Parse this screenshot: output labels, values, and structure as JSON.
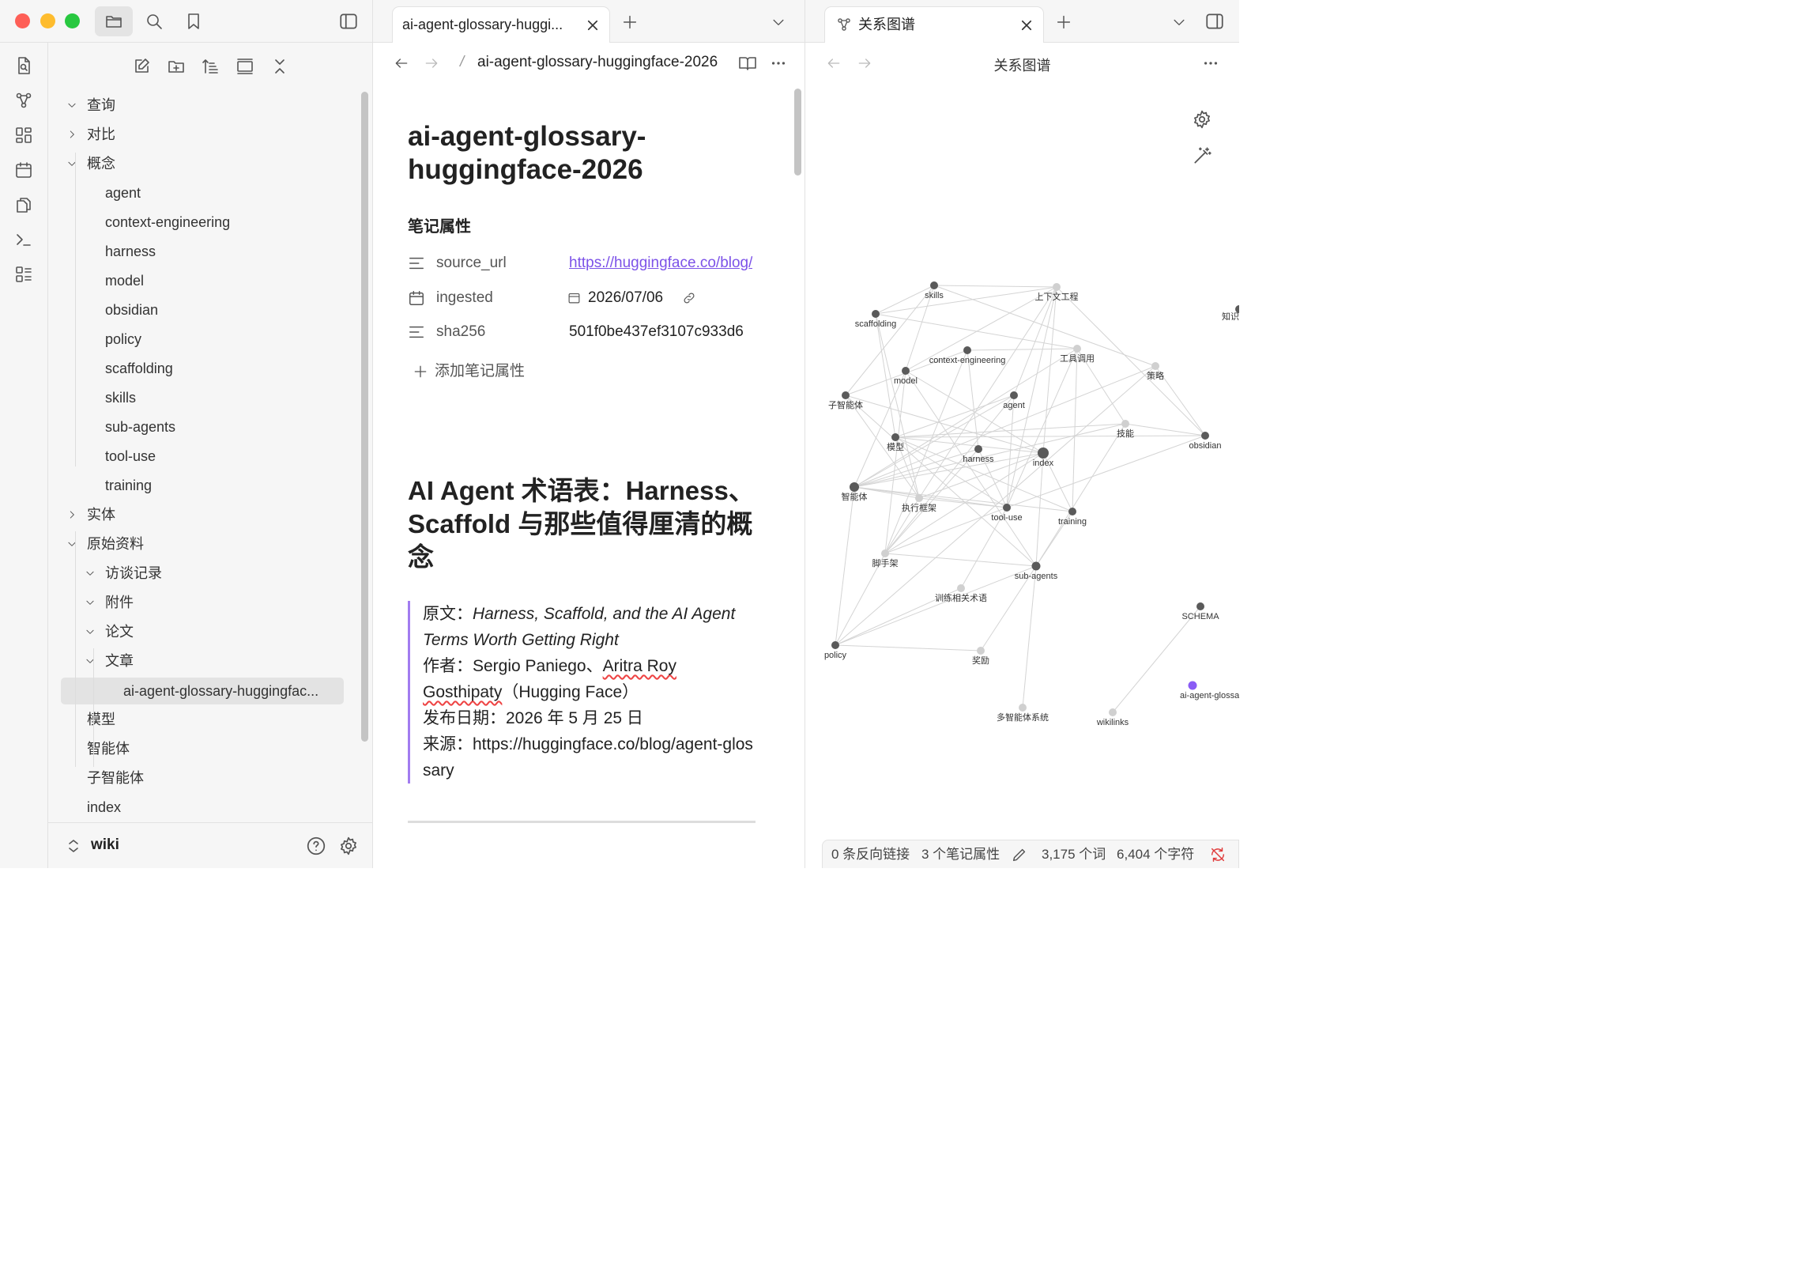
{
  "sidebar": {
    "vault_name": "wiki",
    "tree": [
      {
        "label": "查询",
        "type": "folder",
        "expanded": true
      },
      {
        "label": "对比",
        "type": "folder",
        "expanded": false
      },
      {
        "label": "概念",
        "type": "folder",
        "expanded": true
      },
      {
        "label": "agent",
        "type": "file"
      },
      {
        "label": "context-engineering",
        "type": "file"
      },
      {
        "label": "harness",
        "type": "file"
      },
      {
        "label": "model",
        "type": "file"
      },
      {
        "label": "obsidian",
        "type": "file"
      },
      {
        "label": "policy",
        "type": "file"
      },
      {
        "label": "scaffolding",
        "type": "file"
      },
      {
        "label": "skills",
        "type": "file"
      },
      {
        "label": "sub-agents",
        "type": "file"
      },
      {
        "label": "tool-use",
        "type": "file"
      },
      {
        "label": "training",
        "type": "file"
      },
      {
        "label": "实体",
        "type": "folder",
        "expanded": false
      },
      {
        "label": "原始资料",
        "type": "folder",
        "expanded": true
      },
      {
        "label": "访谈记录",
        "type": "folder",
        "expanded": true
      },
      {
        "label": "附件",
        "type": "folder",
        "expanded": true
      },
      {
        "label": "论文",
        "type": "folder",
        "expanded": true
      },
      {
        "label": "文章",
        "type": "folder",
        "expanded": true
      },
      {
        "label": "ai-agent-glossary-huggingfac...",
        "type": "file",
        "selected": true
      },
      {
        "label": "模型",
        "type": "file"
      },
      {
        "label": "智能体",
        "type": "file"
      },
      {
        "label": "子智能体",
        "type": "file"
      },
      {
        "label": "index",
        "type": "file"
      }
    ]
  },
  "left_pane": {
    "tab_title": "ai-agent-glossary-huggi...",
    "breadcrumb_sep": "/",
    "breadcrumb": "ai-agent-glossary-huggingface-2026",
    "note_title": "ai-agent-glossary-huggingface-2026",
    "properties_heading": "笔记属性",
    "properties": [
      {
        "key": "source_url",
        "value": "https://huggingface.co/blog/agent-glossary",
        "icon": "text-lines-icon"
      },
      {
        "key": "ingested",
        "value": "2026/07/06",
        "icon": "calendar-icon"
      },
      {
        "key": "sha256",
        "value": "501f0be437ef3107c933d6",
        "icon": "text-lines-icon"
      }
    ],
    "add_property_label": "添加笔记属性",
    "article_title": "AI Agent 术语表：Harness、Scaffold 与那些值得厘清的概念",
    "quote": {
      "original_label": "原文：",
      "original_title": "Harness, Scaffold, and the AI Agent Terms Worth Getting Right",
      "author_label": "作者：",
      "author_a": "Sergio Paniego、",
      "author_b": "Aritra Roy",
      "author_c": "Gosthipaty",
      "author_d": "（Hugging Face）",
      "date_line": "发布日期：2026 年 5 月 25 日",
      "source_line": "来源：https://huggingface.co/blog/agent-glossary"
    }
  },
  "right_pane": {
    "tab_title": "关系图谱",
    "header_title": "关系图谱",
    "accent": "#8a5cf5",
    "graph_nodes": [
      {
        "id": "skills",
        "label": "skills",
        "tone": "dark"
      },
      {
        "id": "shangxiawen",
        "label": "上下文工程",
        "tone": "light"
      },
      {
        "id": "scaffolding",
        "label": "scaffolding",
        "tone": "dark"
      },
      {
        "id": "context",
        "label": "context-engineering",
        "tone": "dark"
      },
      {
        "id": "gongju",
        "label": "工具调用",
        "tone": "light"
      },
      {
        "id": "celue",
        "label": "策略",
        "tone": "light"
      },
      {
        "id": "model",
        "label": "model",
        "tone": "dark"
      },
      {
        "id": "zizhineng",
        "label": "子智能体",
        "tone": "dark"
      },
      {
        "id": "agent",
        "label": "agent",
        "tone": "dark"
      },
      {
        "id": "jineng",
        "label": "技能",
        "tone": "light"
      },
      {
        "id": "obsidian",
        "label": "obsidian",
        "tone": "dark"
      },
      {
        "id": "moxing",
        "label": "模型",
        "tone": "dark"
      },
      {
        "id": "harness",
        "label": "harness",
        "tone": "dark"
      },
      {
        "id": "index",
        "label": "index",
        "tone": "dark"
      },
      {
        "id": "zhinengti",
        "label": "智能体",
        "tone": "dark"
      },
      {
        "id": "zhixing",
        "label": "执行框架",
        "tone": "light"
      },
      {
        "id": "tooluse",
        "label": "tool-use",
        "tone": "dark"
      },
      {
        "id": "training",
        "label": "training",
        "tone": "dark"
      },
      {
        "id": "jiaoshoujia",
        "label": "脚手架",
        "tone": "light"
      },
      {
        "id": "subagents",
        "label": "sub-agents",
        "tone": "dark"
      },
      {
        "id": "xunlian",
        "label": "训练相关术语",
        "tone": "light"
      },
      {
        "id": "schema",
        "label": "SCHEMA",
        "tone": "dark"
      },
      {
        "id": "policy",
        "label": "policy",
        "tone": "dark"
      },
      {
        "id": "jiangli",
        "label": "奖励",
        "tone": "light"
      },
      {
        "id": "aiagent",
        "label": "ai-agent-glossary-huggingface",
        "tone": "accent"
      },
      {
        "id": "duozhineng",
        "label": "多智能体系统",
        "tone": "light"
      },
      {
        "id": "wikilinks",
        "label": "wikilinks",
        "tone": "light"
      },
      {
        "id": "zhishi",
        "label": "知识",
        "tone": "dark"
      }
    ],
    "graph_edges": [
      [
        "skills",
        "shangxiawen"
      ],
      [
        "skills",
        "scaffolding"
      ],
      [
        "skills",
        "model"
      ],
      [
        "skills",
        "zizhineng"
      ],
      [
        "skills",
        "celue"
      ],
      [
        "shangxiawen",
        "scaffolding"
      ],
      [
        "shangxiawen",
        "model"
      ],
      [
        "shangxiawen",
        "agent"
      ],
      [
        "shangxiawen",
        "index"
      ],
      [
        "shangxiawen",
        "obsidian"
      ],
      [
        "shangxiawen",
        "zhixing"
      ],
      [
        "shangxiawen",
        "tooluse"
      ],
      [
        "scaffolding",
        "moxing"
      ],
      [
        "scaffolding",
        "zhixing"
      ],
      [
        "scaffolding",
        "gongju"
      ],
      [
        "context",
        "zizhineng"
      ],
      [
        "context",
        "jiaoshoujia"
      ],
      [
        "context",
        "gongju"
      ],
      [
        "context",
        "harness"
      ],
      [
        "gongju",
        "tooluse"
      ],
      [
        "gongju",
        "training"
      ],
      [
        "gongju",
        "zhinengti"
      ],
      [
        "gongju",
        "jineng"
      ],
      [
        "celue",
        "obsidian"
      ],
      [
        "celue",
        "zhinengti"
      ],
      [
        "celue",
        "policy"
      ],
      [
        "model",
        "zhinengti"
      ],
      [
        "model",
        "index"
      ],
      [
        "model",
        "subagents"
      ],
      [
        "model",
        "jiaoshoujia"
      ],
      [
        "zizhineng",
        "index"
      ],
      [
        "zizhineng",
        "subagents"
      ],
      [
        "zizhineng",
        "zhixing"
      ],
      [
        "agent",
        "zhinengti"
      ],
      [
        "agent",
        "jiaoshoujia"
      ],
      [
        "agent",
        "moxing"
      ],
      [
        "agent",
        "tooluse"
      ],
      [
        "jineng",
        "obsidian"
      ],
      [
        "jineng",
        "subagents"
      ],
      [
        "jineng",
        "zhinengti"
      ],
      [
        "jineng",
        "moxing"
      ],
      [
        "obsidian",
        "moxing"
      ],
      [
        "obsidian",
        "tooluse"
      ],
      [
        "moxing",
        "index"
      ],
      [
        "moxing",
        "zhixing"
      ],
      [
        "moxing",
        "training"
      ],
      [
        "moxing",
        "tooluse"
      ],
      [
        "harness",
        "zhinengti"
      ],
      [
        "harness",
        "tooluse"
      ],
      [
        "harness",
        "jiaoshoujia"
      ],
      [
        "index",
        "zhinengti"
      ],
      [
        "index",
        "zhixing"
      ],
      [
        "index",
        "jiaoshoujia"
      ],
      [
        "index",
        "subagents"
      ],
      [
        "index",
        "training"
      ],
      [
        "zhinengti",
        "tooluse"
      ],
      [
        "zhinengti",
        "zhixing"
      ],
      [
        "zhinengti",
        "policy"
      ],
      [
        "zhinengti",
        "training"
      ],
      [
        "zhixing",
        "tooluse"
      ],
      [
        "zhixing",
        "jiaoshoujia"
      ],
      [
        "tooluse",
        "jiaoshoujia"
      ],
      [
        "tooluse",
        "xunlian"
      ],
      [
        "training",
        "subagents"
      ],
      [
        "jiaoshoujia",
        "subagents"
      ],
      [
        "jiaoshoujia",
        "policy"
      ],
      [
        "subagents",
        "jiangli"
      ],
      [
        "subagents",
        "duozhineng"
      ],
      [
        "subagents",
        "policy"
      ],
      [
        "policy",
        "jiangli"
      ],
      [
        "policy",
        "xunlian"
      ],
      [
        "schema",
        "wikilinks"
      ]
    ]
  },
  "status_bar": {
    "backlinks": "0 条反向链接",
    "properties": "3 个笔记属性",
    "words": "3,175 个词",
    "chars": "6,404 个字符"
  }
}
